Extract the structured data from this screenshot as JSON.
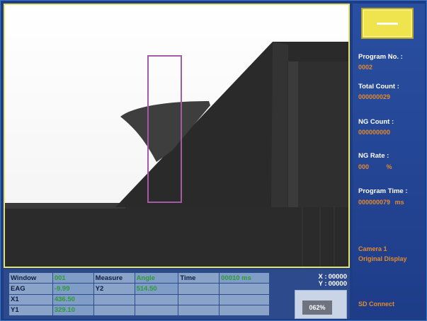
{
  "side_panel": {
    "program_no_label": "Program No. :",
    "program_no_value": "0002",
    "total_count_label": "Total Count :",
    "total_count_value": "000000029",
    "ng_count_label": "NG Count :",
    "ng_count_value": "000000000",
    "ng_rate_label": "NG Rate :",
    "ng_rate_value": "000",
    "ng_rate_unit": "%",
    "program_time_label": "Program Time :",
    "program_time_value": "000000079",
    "program_time_unit": "ms",
    "camera_line1": "Camera 1",
    "camera_line2": "Original Display",
    "sd_connect": "SD Connect",
    "top_button_icon": "minus-icon"
  },
  "measurement_table": {
    "header": {
      "window_label": "Window",
      "window_value": "001",
      "measure_label": "Measure",
      "measure_value": "Angle",
      "time_label": "Time",
      "time_value": "00010 ms"
    },
    "rows": [
      {
        "name": "EAG",
        "value": "-9.99",
        "name2": "Y2",
        "value2": "514.50"
      },
      {
        "name": "X1",
        "value": "436.50",
        "name2": "",
        "value2": ""
      },
      {
        "name": "Y1",
        "value": "329.10",
        "name2": "",
        "value2": ""
      }
    ]
  },
  "coordinates": {
    "x_label": "X :",
    "x_value": "00000",
    "y_label": "Y :",
    "y_value": "00000"
  },
  "zoom": {
    "value": "062%"
  },
  "colors": {
    "panel_bg": "#1e3c88",
    "accent_yellow": "#efe44e",
    "value_orange": "#e38a2e",
    "table_green": "#2e9a34"
  }
}
